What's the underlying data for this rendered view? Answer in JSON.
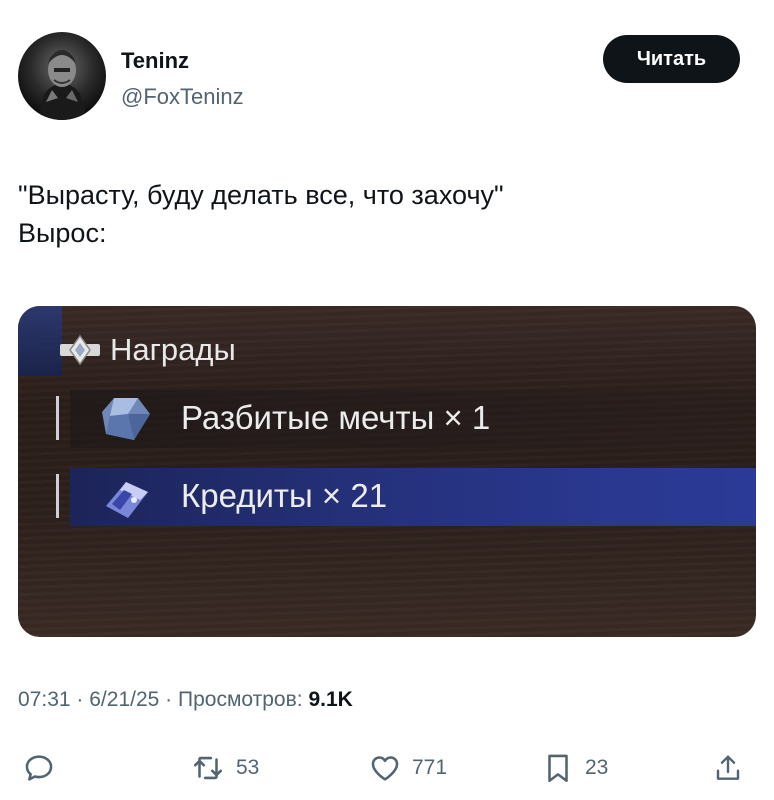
{
  "author": {
    "name": "Teninz",
    "handle": "@FoxTeninz",
    "follow_label": "Читать"
  },
  "tweet": {
    "lines": [
      "\"Вырасту, буду делать все, что захочу\"",
      "Вырос:"
    ]
  },
  "media": {
    "rewards_title": "Награды",
    "items": [
      {
        "label": "Разбитые мечты × 1",
        "icon": "crystal-icon"
      },
      {
        "label": "Кредиты × 21",
        "icon": "credits-chip-icon"
      }
    ]
  },
  "meta": {
    "time": "07:31",
    "date": "6/21/25",
    "views_label": "Просмотров:",
    "views_count": "9.1K",
    "separator": "·"
  },
  "actions": {
    "reply": {
      "icon": "reply-icon",
      "count": ""
    },
    "retweet": {
      "icon": "retweet-icon",
      "count": "53"
    },
    "like": {
      "icon": "heart-icon",
      "count": "771"
    },
    "bookmark": {
      "icon": "bookmark-icon",
      "count": "23"
    },
    "share": {
      "icon": "share-icon",
      "count": ""
    }
  },
  "colors": {
    "text": "#0f1419",
    "secondary": "#536471",
    "button_bg": "#0f1419"
  }
}
